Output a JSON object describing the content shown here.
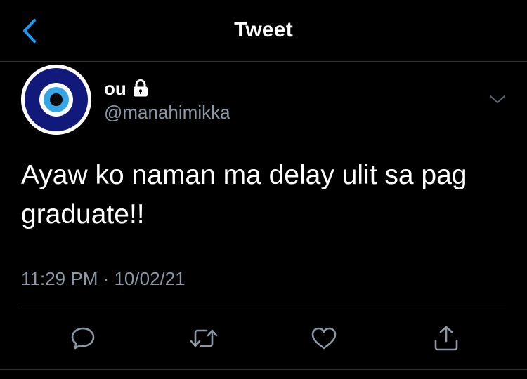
{
  "header": {
    "back_icon": "chevron-left-icon",
    "title": "Tweet"
  },
  "tweet": {
    "author": {
      "display_name": "ou",
      "locked_icon": "lock-icon",
      "handle": "@manahimikka",
      "avatar_icon": "evil-eye-avatar"
    },
    "text": "Ayaw ko naman ma delay ulit sa pag graduate!!",
    "timestamp": "11:29 PM · 10/02/21",
    "actions": [
      {
        "name": "reply",
        "icon": "reply-icon"
      },
      {
        "name": "retweet",
        "icon": "retweet-icon"
      },
      {
        "name": "like",
        "icon": "heart-icon"
      },
      {
        "name": "share",
        "icon": "share-icon"
      }
    ]
  },
  "colors": {
    "background": "#000000",
    "text": "#ffffff",
    "muted": "#8b98a5",
    "accent": "#1d9bf0",
    "divider": "#2f3336"
  }
}
